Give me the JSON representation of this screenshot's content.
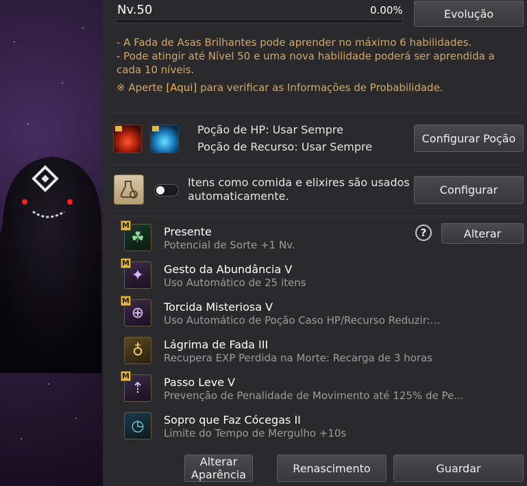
{
  "level": {
    "label": "Nv.50",
    "percent": "0.00%",
    "progress": 0.0
  },
  "buttons": {
    "evolution": "Evolução",
    "config_potion": "Configurar Poção",
    "config": "Configurar",
    "change": "Alterar",
    "change_appearance": "Alterar Aparência",
    "rebirth": "Renascimento",
    "store": "Guardar"
  },
  "notes": {
    "line1": "- A Fada de Asas Brilhantes pode aprender no máximo 6 habilidades.",
    "line2": "- Pode atingir até Nível 50 e uma nova habilidade poderá ser aprendida a",
    "line3": "cada 10 níveis.",
    "line4_prefix": "※ Aperte ",
    "line4_link": "[Aqui]",
    "line4_suffix": " para verificar as Informações de Probabilidade."
  },
  "potions": {
    "hp": "Poção de HP: Usar Sempre",
    "resource": "Poção de Recurso: Usar Sempre"
  },
  "auto_items": {
    "text1": "Itens como comida e elixires são usados",
    "text2": "automaticamente.",
    "toggle_on": false
  },
  "skills": [
    {
      "title": "Presente",
      "desc": "Potencial de Sorte +1 Nv.",
      "badge": "M",
      "icon": "clover-icon"
    },
    {
      "title": "Gesto da Abundância V",
      "desc": "Uso Automático de 25 itens",
      "badge": "M",
      "icon": "fairy-icon"
    },
    {
      "title": "Torcida Misteriosa V",
      "desc": "Uso Automático de Poção Caso HP/Recurso Reduzir:...",
      "badge": "M",
      "icon": "potion-plus-icon"
    },
    {
      "title": "Lágrima de Fada III",
      "desc": "Recupera EXP Perdida na Morte: Recarga de 3 horas",
      "badge": "",
      "icon": "winged-tear-icon"
    },
    {
      "title": "Passo Leve V",
      "desc": "Prevenção de Penalidade de Movimento até 125% de Pe...",
      "badge": "M",
      "icon": "boot-icon"
    },
    {
      "title": "Sopro que Faz Cócegas II",
      "desc": "Limite do Tempo de Mergulho +10s",
      "badge": "",
      "icon": "bubble-timer-icon"
    }
  ],
  "help": "?",
  "colors": {
    "accent_link": "#f2b440",
    "note": "#d2a86a",
    "badge": "#e2b84a"
  }
}
